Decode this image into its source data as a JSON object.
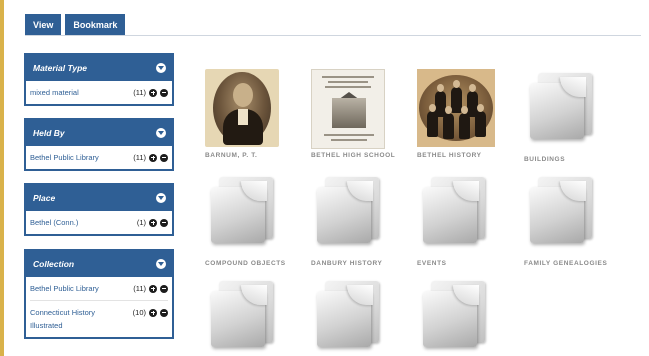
{
  "tabs": [
    {
      "label": "View"
    },
    {
      "label": "Bookmark"
    }
  ],
  "facets": [
    {
      "title": "Material Type",
      "items": [
        {
          "name": "mixed material",
          "count": "(11)"
        }
      ]
    },
    {
      "title": "Held By",
      "items": [
        {
          "name": "Bethel Public Library",
          "count": "(11)"
        }
      ]
    },
    {
      "title": "Place",
      "items": [
        {
          "name": "Bethel (Conn.)",
          "count": "(1)"
        }
      ]
    },
    {
      "title": "Collection",
      "items": [
        {
          "name": "Bethel Public Library",
          "count": "(11)"
        },
        {
          "name": "Connecticut History Illustrated",
          "count": "(10)"
        }
      ]
    }
  ],
  "gallery": [
    {
      "caption": "BARNUM, P. T.",
      "thumb": "portrait-photo"
    },
    {
      "caption": "BETHEL HIGH SCHOOL",
      "thumb": "document-photo"
    },
    {
      "caption": "BETHEL HISTORY",
      "thumb": "group-photo"
    },
    {
      "caption": "BUILDINGS",
      "thumb": "folder-icon"
    },
    {
      "caption": "COMPOUND OBJECTS",
      "thumb": "folder-icon"
    },
    {
      "caption": "DANBURY HISTORY",
      "thumb": "folder-icon"
    },
    {
      "caption": "EVENTS",
      "thumb": "folder-icon"
    },
    {
      "caption": "FAMILY GENEALOGIES",
      "thumb": "folder-icon"
    },
    {
      "caption": "",
      "thumb": "folder-icon"
    },
    {
      "caption": "",
      "thumb": "folder-icon"
    },
    {
      "caption": "",
      "thumb": "folder-icon"
    }
  ],
  "colors": {
    "accent": "#2f5f95",
    "caption": "#8a8a8a",
    "strip": "#d9b24a"
  }
}
